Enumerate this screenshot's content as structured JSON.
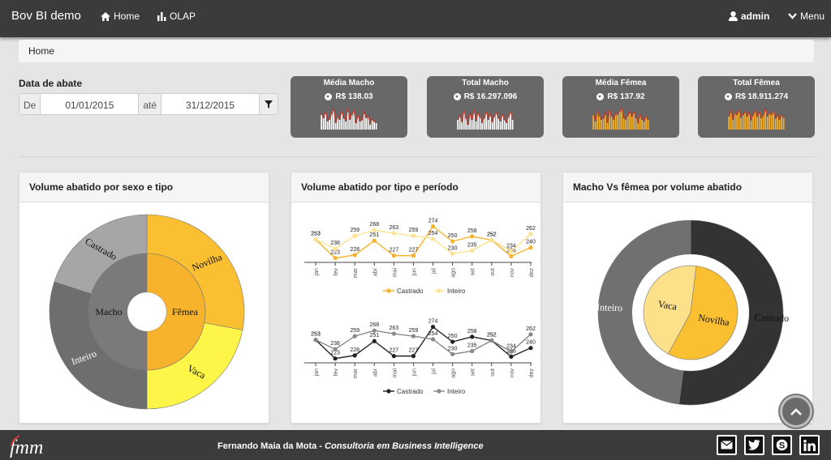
{
  "app": {
    "title": "Bov BI demo"
  },
  "nav": {
    "home": "Home",
    "olap": "OLAP",
    "user": "admin",
    "menu": "Menu"
  },
  "breadcrumb": "Home",
  "filter": {
    "title": "Data de abate",
    "from_label": "De",
    "from": "01/01/2015",
    "to_label": "até",
    "to": "31/12/2015"
  },
  "kpis": [
    {
      "title": "Média Macho",
      "value": "R$ 138.03",
      "color": "#ffffff"
    },
    {
      "title": "Total Macho",
      "value": "R$ 16.297.096",
      "color": "#ffffff"
    },
    {
      "title": "Média Fêmea",
      "value": "R$ 137.92",
      "color": "#f7b32b"
    },
    {
      "title": "Total Fêmea",
      "value": "R$ 18.911.274",
      "color": "#f7b32b"
    }
  ],
  "panels": {
    "sunburst": {
      "title": "Volume abatido por sexo e tipo"
    },
    "lines": {
      "title": "Volume abatido por tipo e período"
    },
    "donut": {
      "title": "Macho Vs fêmea por volume abatido"
    }
  },
  "chart_data": [
    {
      "type": "sunburst",
      "inner": [
        {
          "name": "Macho",
          "value": 50
        },
        {
          "name": "Fêmea",
          "value": 50
        }
      ],
      "outer": [
        {
          "name": "Castrado",
          "value": 20
        },
        {
          "name": "Inteiro",
          "value": 30
        },
        {
          "name": "Novilha",
          "value": 28
        },
        {
          "name": "Vaca",
          "value": 22
        }
      ],
      "colors": {
        "Macho": "#7a7a7a",
        "Fêmea": "#f7b32b",
        "Castrado": "#a6a6a6",
        "Inteiro": "#6e6e6e",
        "Novilha": "#fbbf32",
        "Vaca": "#fdf547"
      }
    },
    {
      "type": "line",
      "categories": [
        "jan",
        "fev",
        "mar",
        "abr",
        "mai",
        "jun",
        "jul",
        "ago",
        "set",
        "out",
        "nov",
        "dez"
      ],
      "series": [
        {
          "name": "Castrado",
          "values": [
            253,
            223,
            228,
            251,
            227,
            227,
            274,
            250,
            258,
            252,
            226,
            240
          ]
        },
        {
          "name": "Inteiro",
          "values": [
            253,
            238,
            259,
            268,
            263,
            259,
            254,
            230,
            235,
            252,
            234,
            262
          ]
        }
      ],
      "colors": {
        "Castrado": "#f7b32b",
        "Inteiro": "#fde28f"
      }
    },
    {
      "type": "line",
      "categories": [
        "jan",
        "fev",
        "mar",
        "abr",
        "mai",
        "jun",
        "jul",
        "ago",
        "set",
        "out",
        "nov",
        "dez"
      ],
      "series": [
        {
          "name": "Castrado",
          "values": [
            253,
            223,
            228,
            251,
            227,
            227,
            274,
            250,
            258,
            252,
            226,
            240
          ]
        },
        {
          "name": "Inteiro",
          "values": [
            253,
            238,
            259,
            268,
            263,
            259,
            254,
            230,
            235,
            252,
            234,
            262
          ]
        }
      ],
      "colors": {
        "Castrado": "#222222",
        "Inteiro": "#888888"
      }
    },
    {
      "type": "pie",
      "outer": [
        {
          "name": "Castrado",
          "value": 52
        },
        {
          "name": "Inteiro",
          "value": 48
        }
      ],
      "inner": [
        {
          "name": "Novilha",
          "value": 56
        },
        {
          "name": "Vaca",
          "value": 44
        }
      ],
      "colors": {
        "Castrado": "#333333",
        "Inteiro": "#707070",
        "Novilha": "#fbbf32",
        "Vaca": "#fde08a"
      }
    }
  ],
  "footer": {
    "name": "Fernando Maia da Mota",
    "sep": " - ",
    "tagline": "Consultoria em Business Intelligence",
    "logo": "fmm"
  }
}
